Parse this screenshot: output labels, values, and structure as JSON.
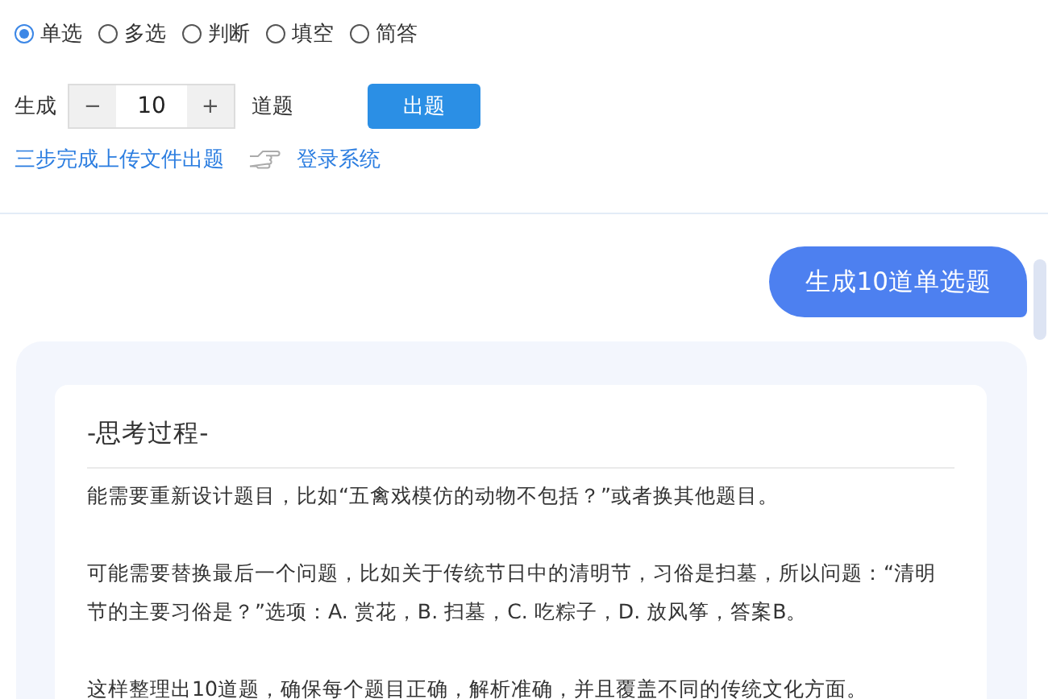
{
  "question_types": [
    {
      "label": "单选",
      "selected": true
    },
    {
      "label": "多选",
      "selected": false
    },
    {
      "label": "判断",
      "selected": false
    },
    {
      "label": "填空",
      "selected": false
    },
    {
      "label": "简答",
      "selected": false
    }
  ],
  "count": {
    "prefix": "生成",
    "minus": "−",
    "value": "10",
    "plus": "+",
    "suffix": "道题",
    "submit": "出题"
  },
  "links": {
    "upload": "三步完成上传文件出题",
    "login": "登录系统"
  },
  "chat": {
    "user_message": "生成10道单选题",
    "thinking_title": "-思考过程-",
    "paragraphs": [
      "能需要重新设计题目，比如“五禽戏模仿的动物不包括？”或者换其他题目。",
      "可能需要替换最后一个问题，比如关于传统节日中的清明节，习俗是扫墓，所以问题：“清明节的主要习俗是？”选项：A. 赏花，B. 扫墓，C. 吃粽子，D. 放风筝，答案B。",
      "这样整理出10道题，确保每个题目正确，解析准确，并且覆盖不同的传统文化方面。"
    ]
  }
}
